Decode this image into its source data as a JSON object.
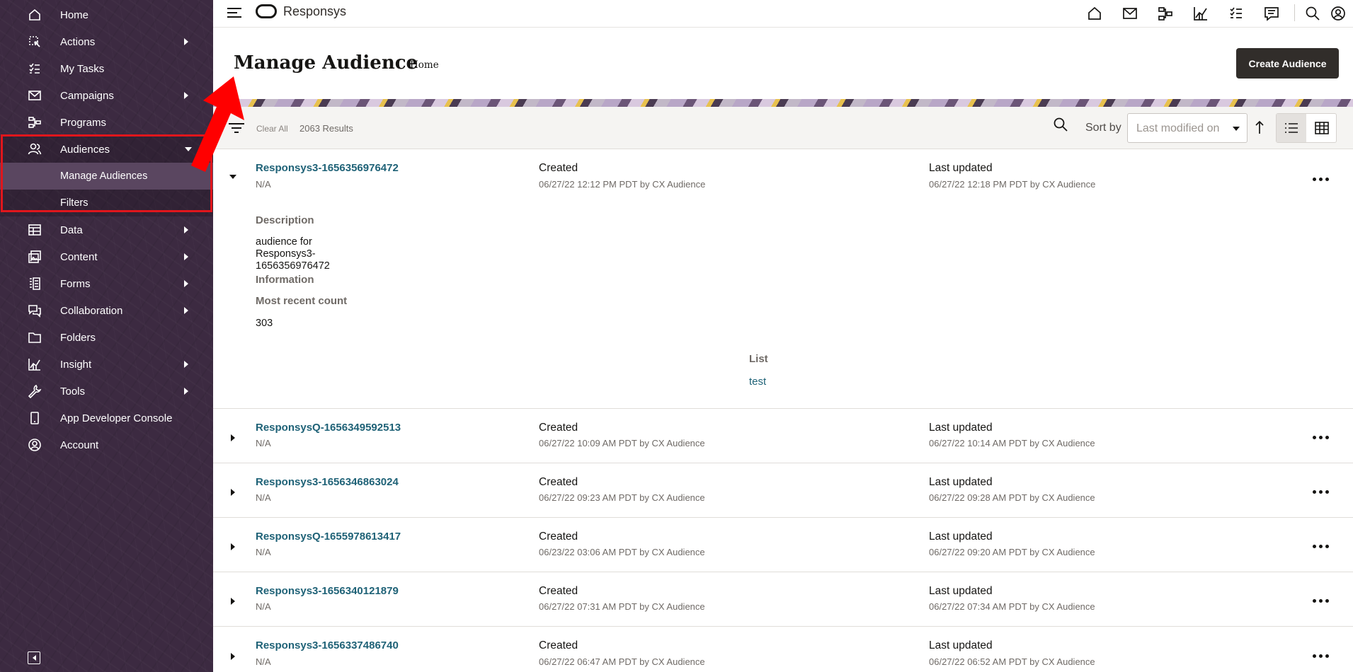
{
  "app": {
    "title": "Responsys"
  },
  "sidebar": {
    "items": [
      {
        "label": "Home",
        "icon": "home-icon"
      },
      {
        "label": "Actions",
        "icon": "actions-icon"
      },
      {
        "label": "My Tasks",
        "icon": "tasks-icon"
      },
      {
        "label": "Campaigns",
        "icon": "mail-icon"
      },
      {
        "label": "Programs",
        "icon": "programs-icon"
      },
      {
        "label": "Audiences",
        "icon": "users-icon"
      },
      {
        "label": "Data",
        "icon": "table-icon"
      },
      {
        "label": "Content",
        "icon": "content-icon"
      },
      {
        "label": "Forms",
        "icon": "forms-icon"
      },
      {
        "label": "Collaboration",
        "icon": "chat-icon"
      },
      {
        "label": "Folders",
        "icon": "folder-icon"
      },
      {
        "label": "Insight",
        "icon": "chart-icon"
      },
      {
        "label": "Tools",
        "icon": "wrench-icon"
      },
      {
        "label": "App Developer Console",
        "icon": "device-icon"
      },
      {
        "label": "Account",
        "icon": "account-icon"
      }
    ],
    "sub_items": [
      {
        "label": "Manage Audiences"
      },
      {
        "label": "Filters"
      }
    ],
    "highlight_color": "#e0161c"
  },
  "header": {
    "title": "Manage Audience",
    "breadcrumb_sep": "/",
    "breadcrumb": "Home",
    "create_button": "Create Audience"
  },
  "toolbar": {
    "clear_all": "Clear All",
    "results": "2063 Results",
    "sort_label": "Sort by",
    "sort_value": "Last modified on"
  },
  "labels": {
    "created": "Created",
    "updated": "Last updated",
    "description": "Description",
    "information": "Information",
    "most_recent_count": "Most recent count",
    "list": "List"
  },
  "expanded": {
    "description_text": "audience for Responsys3-1656356976472",
    "count": "303",
    "list_value": "test"
  },
  "rows": [
    {
      "name": "Responsys3-1656356976472",
      "sub": "N/A",
      "created": "06/27/22 12:12 PM PDT by CX Audience",
      "updated": "06/27/22 12:18 PM PDT by CX Audience"
    },
    {
      "name": "ResponsysQ-1656349592513",
      "sub": "N/A",
      "created": "06/27/22 10:09 AM PDT by CX Audience",
      "updated": "06/27/22 10:14 AM PDT by CX Audience"
    },
    {
      "name": "Responsys3-1656346863024",
      "sub": "N/A",
      "created": "06/27/22 09:23 AM PDT by CX Audience",
      "updated": "06/27/22 09:28 AM PDT by CX Audience"
    },
    {
      "name": "ResponsysQ-1655978613417",
      "sub": "N/A",
      "created": "06/23/22 03:06 AM PDT by CX Audience",
      "updated": "06/27/22 09:20 AM PDT by CX Audience"
    },
    {
      "name": "Responsys3-1656340121879",
      "sub": "N/A",
      "created": "06/27/22 07:31 AM PDT by CX Audience",
      "updated": "06/27/22 07:34 AM PDT by CX Audience"
    },
    {
      "name": "Responsys3-1656337486740",
      "sub": "N/A",
      "created": "06/27/22 06:47 AM PDT by CX Audience",
      "updated": "06/27/22 06:52 AM PDT by CX Audience"
    }
  ]
}
